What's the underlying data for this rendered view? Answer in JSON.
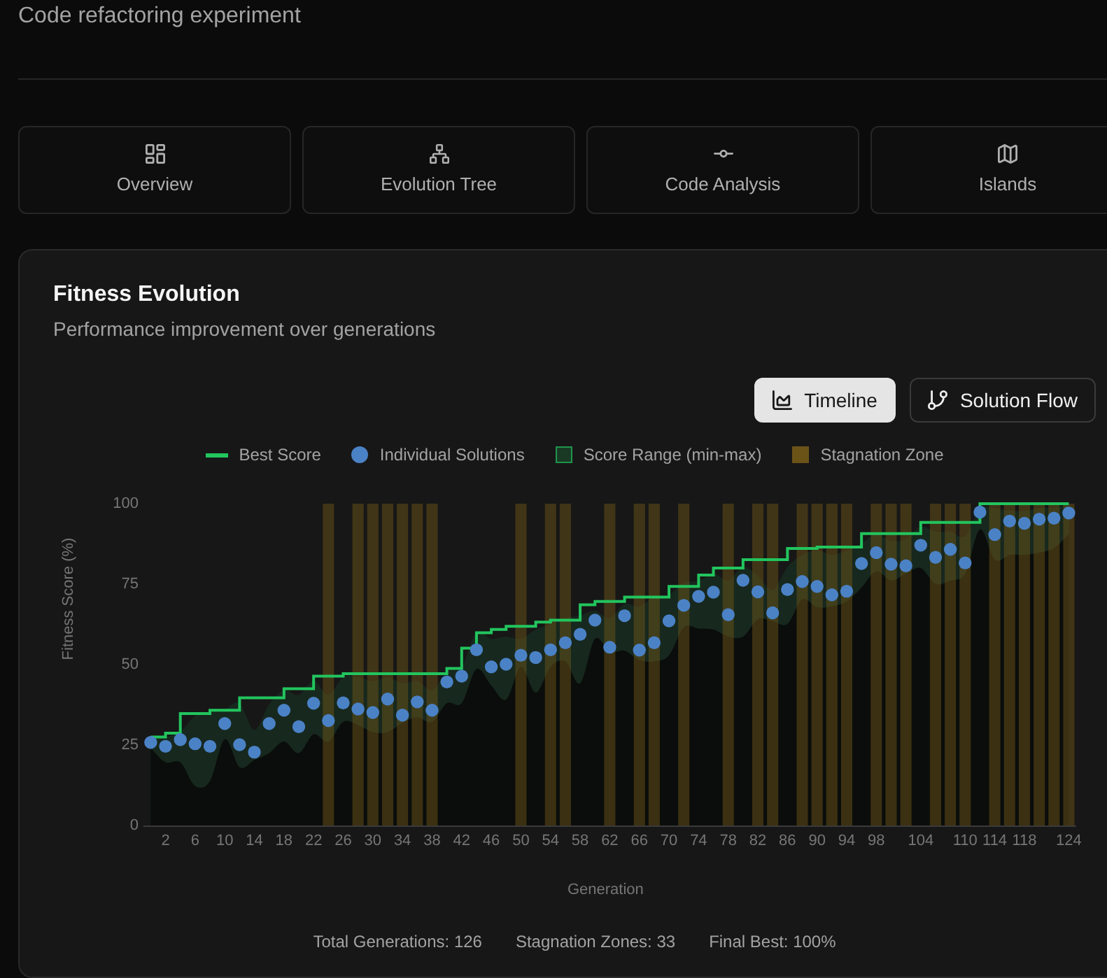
{
  "header": {
    "description": "Code refactoring experiment"
  },
  "tabs": [
    {
      "label": "Overview",
      "selected": false
    },
    {
      "label": "Evolution Tree",
      "selected": false
    },
    {
      "label": "Code Analysis",
      "selected": false
    },
    {
      "label": "Islands",
      "selected": false
    }
  ],
  "fitness_card": {
    "title": "Fitness Evolution",
    "description": "Performance improvement over generations",
    "views": [
      {
        "label": "Timeline",
        "selected": true
      },
      {
        "label": "Solution Flow",
        "selected": false
      }
    ],
    "chart_data": {
      "type": "line",
      "xlabel": "Generation",
      "ylabel": "Fitness Score (%)",
      "xlim": [
        -1,
        125
      ],
      "ylim": [
        0,
        100
      ],
      "yticks": [
        0,
        25,
        50,
        75,
        100
      ],
      "x": [
        0,
        2,
        4,
        6,
        8,
        10,
        12,
        14,
        16,
        18,
        20,
        22,
        24,
        26,
        28,
        30,
        32,
        34,
        36,
        38,
        40,
        42,
        44,
        46,
        48,
        50,
        52,
        54,
        56,
        58,
        60,
        62,
        64,
        66,
        68,
        70,
        72,
        74,
        76,
        78,
        80,
        82,
        84,
        86,
        88,
        90,
        92,
        94,
        96,
        98,
        100,
        102,
        104,
        106,
        108,
        110,
        112,
        114,
        116,
        118,
        120,
        122,
        124
      ],
      "xticks": [
        2,
        6,
        10,
        14,
        18,
        22,
        26,
        30,
        34,
        38,
        42,
        46,
        50,
        54,
        58,
        62,
        66,
        70,
        74,
        78,
        82,
        86,
        90,
        94,
        98,
        104,
        110,
        114,
        118,
        124
      ],
      "series": [
        {
          "name": "Best Score",
          "color": "#22c55e",
          "x": [
            0,
            2,
            2,
            4,
            4,
            8,
            8,
            12,
            12,
            18,
            18,
            22,
            22,
            26,
            26,
            40,
            40,
            42,
            42,
            44,
            44,
            46,
            46,
            48,
            48,
            52,
            52,
            54,
            54,
            58,
            58,
            60,
            60,
            64,
            64,
            70,
            70,
            74,
            74,
            76,
            76,
            80,
            80,
            86,
            86,
            90,
            90,
            96,
            96,
            104,
            104,
            112,
            112,
            124
          ],
          "values": [
            27.5,
            27.5,
            28.7,
            28.7,
            34.8,
            34.8,
            35.8,
            35.8,
            39.7,
            39.7,
            42.5,
            42.5,
            46.4,
            46.4,
            47.2,
            47.2,
            48.8,
            48.8,
            55.1,
            55.1,
            59.9,
            59.9,
            60.9,
            60.9,
            61.9,
            61.9,
            63.2,
            63.2,
            63.8,
            63.8,
            68.6,
            68.6,
            69.6,
            69.6,
            71.0,
            71.0,
            74.3,
            74.3,
            77.8,
            77.8,
            80.0,
            80.0,
            82.6,
            82.6,
            86.1,
            86.1,
            86.5,
            86.5,
            90.7,
            90.7,
            94.2,
            94.2,
            100,
            100
          ]
        },
        {
          "name": "Individual Solutions",
          "type": "scatter",
          "color": "#4b82c6",
          "values": [
            25.8,
            24.6,
            26.7,
            25.4,
            24.6,
            31.7,
            25.1,
            22.8,
            31.7,
            35.8,
            30.7,
            38.0,
            32.6,
            38.1,
            36.2,
            35.1,
            39.3,
            34.3,
            38.4,
            35.8,
            44.6,
            46.4,
            54.6,
            49.3,
            50.1,
            52.9,
            52.2,
            54.6,
            56.8,
            59.4,
            63.8,
            55.4,
            65.2,
            54.5,
            56.8,
            63.6,
            68.4,
            71.2,
            72.5,
            65.5,
            76.2,
            72.6,
            66.1,
            73.3,
            75.8,
            74.3,
            71.7,
            72.8,
            81.4,
            84.8,
            81.2,
            80.7,
            87.1,
            83.3,
            85.8,
            81.6,
            97.4,
            90.4,
            94.6,
            93.9,
            95.2,
            95.5,
            97.1
          ]
        },
        {
          "name": "Score Range (min-max)",
          "type": "area",
          "color": "#22c55e",
          "values": [
            27.5,
            27.5,
            29.3,
            34.1,
            35.5,
            36.2,
            38.0,
            29.7,
            37.7,
            42.0,
            40.6,
            44.9,
            40.6,
            46.1,
            46.1,
            44.9,
            46.1,
            44.2,
            44.9,
            42.0,
            47.8,
            49.3,
            60.1,
            58.0,
            58.7,
            58.0,
            60.9,
            62.6,
            64.5,
            65.2,
            66.7,
            64.5,
            68.8,
            68.1,
            71.0,
            71.7,
            75.4,
            76.1,
            78.3,
            76.1,
            80.4,
            77.5,
            73.2,
            80.4,
            84.1,
            85.5,
            84.1,
            85.5,
            87.7,
            90.6,
            88.4,
            89.1,
            92.8,
            91.3,
            91.3,
            89.9,
            98.6,
            98.6,
            97.8,
            97.8,
            98.6,
            98.8,
            100
          ]
        },
        {
          "type": "area",
          "color": "#0a0d0b",
          "values": [
            24.0,
            19.6,
            19.6,
            12.3,
            13.8,
            26.8,
            18.1,
            20.3,
            22.5,
            26.1,
            22.5,
            28.3,
            26.1,
            32.2,
            31.2,
            29.0,
            29.0,
            31.9,
            33.6,
            32.2,
            38.0,
            38.0,
            48.6,
            43.5,
            39.1,
            49.3,
            41.3,
            49.3,
            51.0,
            44.2,
            58.0,
            53.9,
            54.3,
            51.4,
            51.0,
            52.9,
            61.6,
            61.2,
            60.9,
            58.7,
            58.7,
            64.1,
            63.5,
            62.6,
            70.3,
            67.8,
            68.1,
            69.6,
            73.9,
            79.0,
            76.1,
            78.3,
            80.0,
            75.1,
            76.1,
            78.3,
            92.0,
            82.6,
            84.1,
            84.1,
            84.8,
            86.2,
            90.6
          ]
        },
        {
          "name": "Stagnation Zone",
          "type": "bar",
          "color": "#6b5318",
          "values": [
            null,
            null,
            null,
            null,
            null,
            null,
            null,
            null,
            null,
            null,
            null,
            null,
            100,
            null,
            100,
            100,
            100,
            100,
            100,
            100,
            null,
            null,
            null,
            null,
            null,
            100,
            null,
            100,
            100,
            null,
            null,
            100,
            null,
            100,
            100,
            null,
            100,
            null,
            null,
            100,
            null,
            100,
            100,
            null,
            100,
            100,
            100,
            100,
            null,
            100,
            100,
            100,
            null,
            100,
            100,
            100,
            null,
            100,
            100,
            100,
            100,
            100,
            100
          ]
        }
      ]
    },
    "stats": [
      "Total Generations: 126",
      "Stagnation Zones: 33",
      "Final Best: 100%"
    ]
  }
}
